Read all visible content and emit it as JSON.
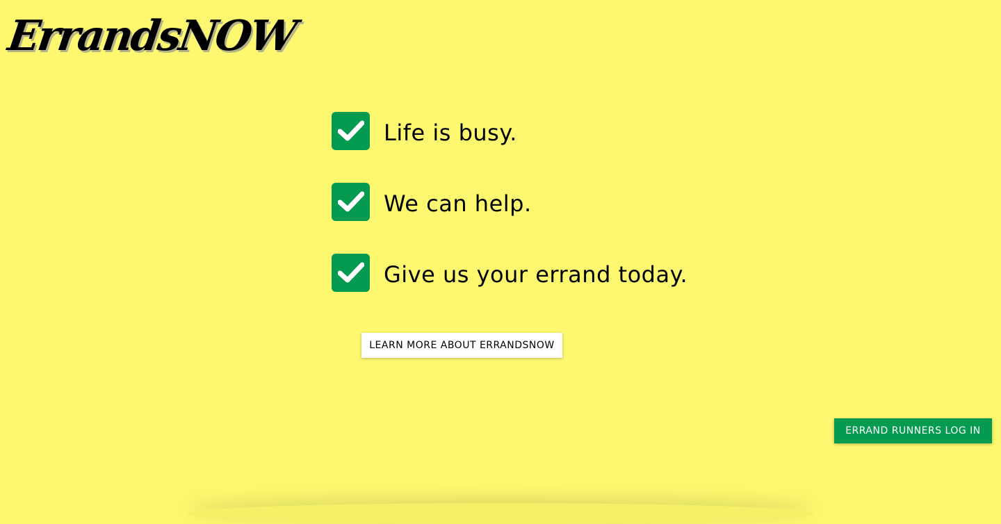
{
  "brand": {
    "logo_text": "ErrandsNOW"
  },
  "checklist": {
    "items": [
      {
        "label": "Life is busy.",
        "icon": "checkmark-icon"
      },
      {
        "label": "We can help.",
        "icon": "checkmark-icon"
      },
      {
        "label": "Give us your errand today.",
        "icon": "checkmark-icon"
      }
    ]
  },
  "buttons": {
    "learn_more_label": "LEARN MORE ABOUT ERRANDSNOW",
    "runner_login_label": "ERRAND RUNNERS LOG IN"
  },
  "colors": {
    "background": "#fdf86f",
    "accent_green": "#049b50",
    "white": "#ffffff",
    "text": "#000000"
  }
}
